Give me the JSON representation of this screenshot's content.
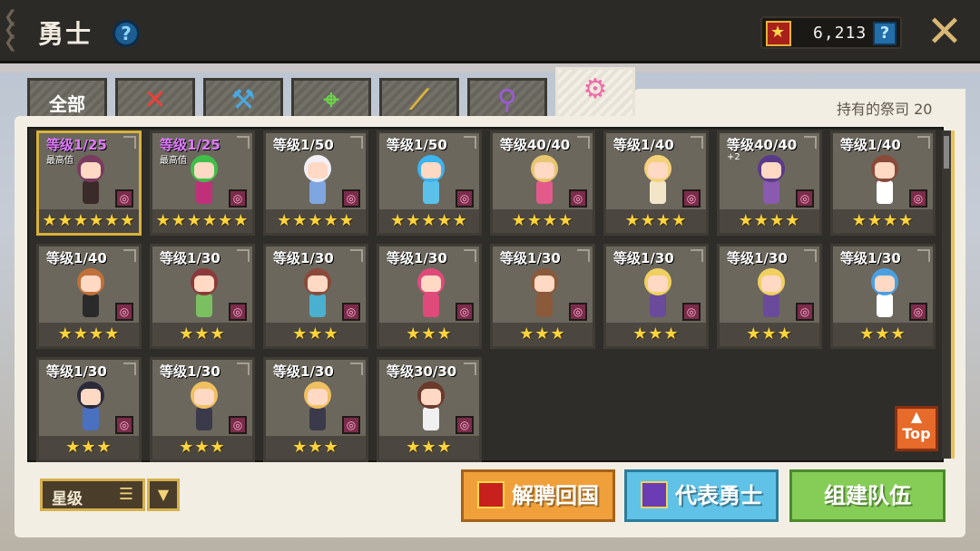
{
  "header": {
    "title": "勇士",
    "currency_amount": "6,213"
  },
  "tabs": [
    {
      "label": "全部",
      "icon": null
    },
    {
      "label": "",
      "icon": "sword-icon",
      "color": "#e8403a"
    },
    {
      "label": "",
      "icon": "hammer-icon",
      "color": "#4aa9e0"
    },
    {
      "label": "",
      "icon": "bow-icon",
      "color": "#6cd24a"
    },
    {
      "label": "",
      "icon": "gun-icon",
      "color": "#e0b23a"
    },
    {
      "label": "",
      "icon": "staff-icon",
      "color": "#9a5ad8"
    },
    {
      "label": "",
      "icon": "priest-icon",
      "color": "#f06aa8"
    }
  ],
  "owned_label": "持有的祭司 20",
  "cards": [
    {
      "level": "等级1/25",
      "max": "最高值",
      "stars": "★★★★★★",
      "purple": true,
      "gold": true,
      "hair": "#7b3a60",
      "outfit": "#3a2a2a"
    },
    {
      "level": "等级1/25",
      "max": "最高值",
      "stars": "★★★★★★",
      "purple": true,
      "gold": false,
      "hair": "#3fbf4a",
      "outfit": "#c0307a"
    },
    {
      "level": "等级1/50",
      "stars": "★★★★★",
      "hair": "#f2f0f6",
      "outfit": "#7fa6e0"
    },
    {
      "level": "等级1/50",
      "stars": "★★★★★",
      "hair": "#3db4f0",
      "outfit": "#5bc0ea"
    },
    {
      "level": "等级40/40",
      "stars": "★★★★",
      "hair": "#e9c770",
      "outfit": "#e25a8a"
    },
    {
      "level": "等级1/40",
      "stars": "★★★★",
      "hair": "#f5d27a",
      "outfit": "#f3e5c8"
    },
    {
      "level": "等级40/40",
      "plus": "+2",
      "stars": "★★★★",
      "hair": "#5a3a8a",
      "outfit": "#8a5ab0"
    },
    {
      "level": "等级1/40",
      "stars": "★★★★",
      "hair": "#8a4a3a",
      "outfit": "#ffffff"
    },
    {
      "level": "等级1/40",
      "stars": "★★★★",
      "hair": "#c0713a",
      "outfit": "#2a2a2a"
    },
    {
      "level": "等级1/30",
      "stars": "★★★",
      "hair": "#8a3a3a",
      "outfit": "#7bc060"
    },
    {
      "level": "等级1/30",
      "stars": "★★★",
      "hair": "#8a4a3a",
      "outfit": "#4ab0d0"
    },
    {
      "level": "等级1/30",
      "stars": "★★★",
      "hair": "#e04a7a",
      "outfit": "#e04a7a"
    },
    {
      "level": "等级1/30",
      "stars": "★★★",
      "hair": "#8a5a3a",
      "outfit": "#8a5a3a"
    },
    {
      "level": "等级1/30",
      "stars": "★★★",
      "hair": "#f0d060",
      "outfit": "#6a4a9a"
    },
    {
      "level": "等级1/30",
      "stars": "★★★",
      "hair": "#f0d060",
      "outfit": "#6a4a9a"
    },
    {
      "level": "等级1/30",
      "stars": "★★★",
      "hair": "#4aa0e0",
      "outfit": "#ffffff"
    },
    {
      "level": "等级1/30",
      "stars": "★★★",
      "hair": "#2a2a3a",
      "outfit": "#4a70c0"
    },
    {
      "level": "等级1/30",
      "stars": "★★★",
      "hair": "#f0c060",
      "outfit": "#3a3a4a"
    },
    {
      "level": "等级1/30",
      "stars": "★★★",
      "hair": "#f0c060",
      "outfit": "#3a3a4a"
    },
    {
      "level": "等级30/30",
      "stars": "★★★",
      "hair": "#6a3a2a",
      "outfit": "#f0f0f0"
    }
  ],
  "top_button": "Top",
  "sort": {
    "label": "星级"
  },
  "buttons": {
    "release": "解聘回国",
    "representative": "代表勇士",
    "team": "组建队伍"
  }
}
